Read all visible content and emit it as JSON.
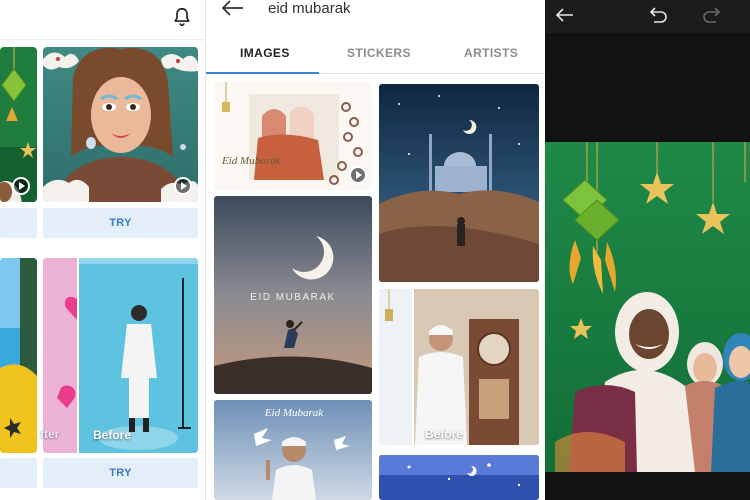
{
  "panel_feed": {
    "notification_icon": "bell-icon",
    "buttons": [
      {
        "label": "TRY"
      },
      {
        "label": "TRY"
      }
    ],
    "before_labels": [
      {
        "label": "fter"
      },
      {
        "label": "Before"
      }
    ]
  },
  "panel_search": {
    "back_icon": "arrow-left-icon",
    "query": "eid mubarak",
    "tabs": [
      {
        "label": "IMAGES",
        "active": true
      },
      {
        "label": "STICKERS",
        "active": false
      },
      {
        "label": "ARTISTS",
        "active": false
      }
    ],
    "accent_color": "#3a82d6",
    "results": [
      {
        "caption": "Eid Mubarak"
      },
      {
        "caption": "EID MUBARAK"
      },
      {
        "caption": "Eid Mubarak"
      }
    ],
    "before_label": "Before"
  },
  "panel_editor": {
    "toolbar": {
      "back_icon": "arrow-left-icon",
      "undo_icon": "undo-icon",
      "redo_icon": "redo-icon"
    }
  }
}
